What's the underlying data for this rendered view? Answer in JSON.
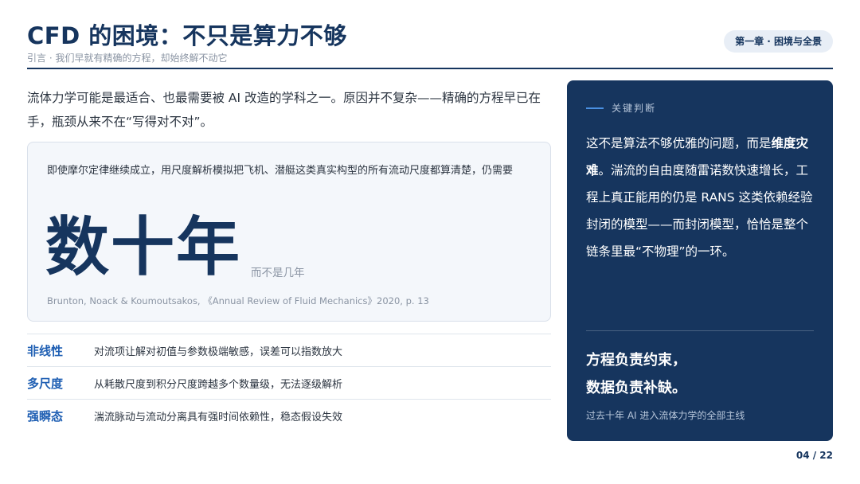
{
  "header": {
    "title": "CFD 的困境：不只是算力不够",
    "subtitle": "引言 · 我们早就有精确的方程，却始终解不动它",
    "chapter_badge": "第一章 · 困境与全景"
  },
  "intro": "流体力学可能是最适合、也最需要被 AI 改造的学科之一。原因并不复杂——精确的方程早已在手，瓶颈从来不在“写得对不对”。",
  "quote": {
    "text": "即使摩尔定律继续成立，用尺度解析模拟把飞机、潜艇这类真实构型的所有流动尺度都算清楚，仍需要",
    "big_number": "数十年",
    "big_suffix": "而不是几年",
    "citation": "Brunton, Noack & Koumoutsakos, 《Annual Review of Fluid Mechanics》2020, p. 13"
  },
  "traits": [
    {
      "name": "非线性",
      "desc": "对流项让解对初值与参数极端敏感，误差可以指数放大"
    },
    {
      "name": "多尺度",
      "desc": "从耗散尺度到积分尺度跨越多个数量级，无法逐级解析"
    },
    {
      "name": "强瞬态",
      "desc": "湍流脉动与流动分离具有强时间依赖性，稳态假设失效"
    }
  ],
  "panel": {
    "kicker": "关键判断",
    "body_pre": "这不是算法不够优雅的问题，而是",
    "body_bold": "维度灾难",
    "body_post": "。湍流的自由度随雷诺数快速增长，工程上真正能用的仍是 RANS 这类依赖经验封闭的模型——而封闭模型，恰恰是整个链条里最“不物理”的一环。",
    "motto_line1": "方程负责约束，",
    "motto_line2": "数据负责补缺。",
    "foot": "过去十年 AI 进入流体力学的全部主线"
  },
  "page_number": "04 / 22",
  "colors": {
    "navy": "#16355e",
    "accent_blue": "#1f5fb3",
    "muted": "#8a94a3"
  }
}
